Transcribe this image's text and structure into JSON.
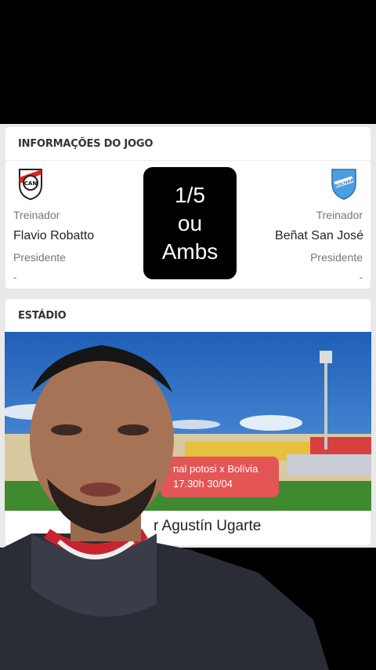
{
  "game_info": {
    "title": "INFORMAÇÕES DO JOGO",
    "home": {
      "coach_label": "Treinador",
      "coach": "Flavio Robatto",
      "president_label": "Presidente",
      "president": "-",
      "logo_text": "CAN"
    },
    "away": {
      "coach_label": "Treinador",
      "coach": "Beñat San José",
      "president_label": "Presidente",
      "president": "-",
      "logo_text": "BOLIVAR"
    }
  },
  "overlay": {
    "line1": "1/5",
    "line2": "ou",
    "line3": "Ambs"
  },
  "stadium": {
    "title": "ESTÁDIO",
    "name": "r Agustín Ugarte",
    "banner_line1": "nal potosi x Bolívia",
    "banner_line2": "17.30h 30/04"
  },
  "colors": {
    "banner": "#e45556",
    "background": "#000000"
  }
}
